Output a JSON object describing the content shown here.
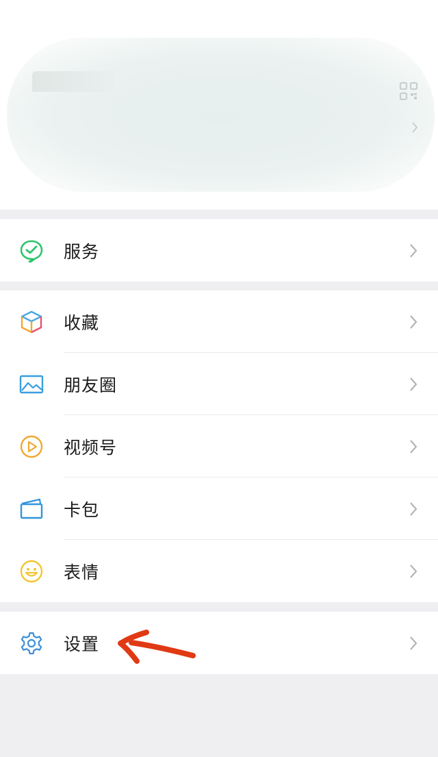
{
  "colors": {
    "background": "#efeef1",
    "card": "#ffffff",
    "text": "#1b1b1b",
    "chevron": "#b4b4b4",
    "annotation_arrow": "#e03a14"
  },
  "profile": {
    "qr_icon": "qr-code-icon",
    "chevron_icon": "chevron-right-icon"
  },
  "menu": {
    "group1": [
      {
        "label": "服务",
        "icon": "service-icon",
        "color": "#2fc46b"
      }
    ],
    "group2": [
      {
        "label": "收藏",
        "icon": "favorites-cube-icon",
        "color": "#4aa7e8"
      },
      {
        "label": "朋友圈",
        "icon": "moments-photo-icon",
        "color": "#3b9ee0"
      },
      {
        "label": "视频号",
        "icon": "channels-play-icon",
        "color": "#f0a830"
      },
      {
        "label": "卡包",
        "icon": "card-wallet-icon",
        "color": "#2f95de"
      },
      {
        "label": "表情",
        "icon": "emoji-smile-icon",
        "color": "#f3c530"
      }
    ],
    "group3": [
      {
        "label": "设置",
        "icon": "settings-gear-icon",
        "color": "#3b8fd9"
      }
    ]
  },
  "annotation": {
    "icon": "red-arrow-annotation"
  }
}
